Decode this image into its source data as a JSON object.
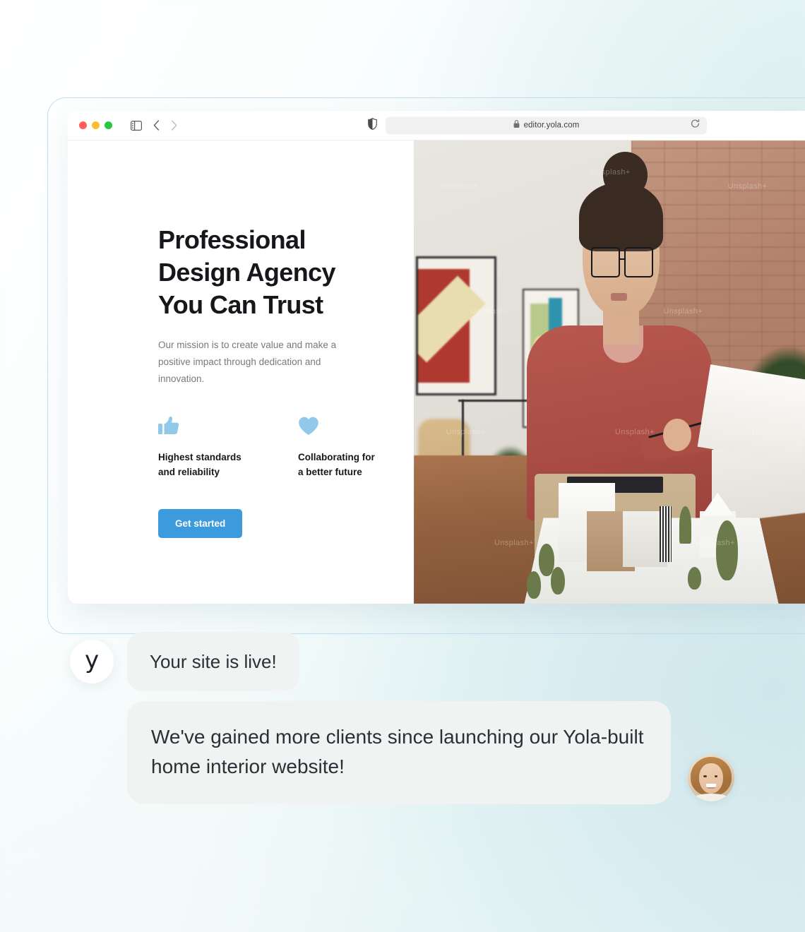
{
  "browser": {
    "traffic_lights": [
      "close",
      "minimize",
      "maximize"
    ],
    "sidebar_icon": "sidebar-toggle-icon",
    "back_icon": "chevron-left-icon",
    "forward_icon": "chevron-right-icon",
    "shield_icon": "privacy-shield-icon",
    "lock_icon": "lock-icon",
    "url": "editor.yola.com",
    "reload_icon": "reload-icon"
  },
  "hero": {
    "title": "Professional Design Agency You Can Trust",
    "subtitle": "Our mission is to create value and make a positive impact through dedication and innovation.",
    "features": [
      {
        "icon": "thumbs-up-icon",
        "label": "Highest standards\nand reliability"
      },
      {
        "icon": "heart-icon",
        "label": "Collaborating for\na better future"
      }
    ],
    "cta_label": "Get started",
    "image_alt": "Woman with glasses in red shirt reviewing plans beside an architectural model"
  },
  "chat": {
    "brand_logo": "y",
    "messages": [
      {
        "sender": "yola",
        "text": "Your site is live!"
      },
      {
        "sender": "customer",
        "text": "We've gained more clients since launching our Yola-built home interior website!"
      }
    ],
    "customer_avatar": "smiling-woman-portrait"
  },
  "colors": {
    "accent_blue": "#3b9bdc",
    "feature_icon_blue": "#92c9ea",
    "bubble_gray": "#f1f2f2",
    "frame_border": "#bfdff0",
    "heading_dark": "#15171a",
    "body_gray": "#77797d"
  }
}
